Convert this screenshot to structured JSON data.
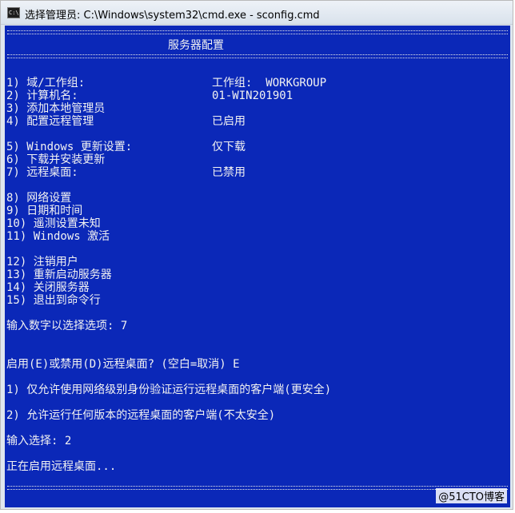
{
  "window": {
    "title": "选择管理员: C:\\Windows\\system32\\cmd.exe - sconfig.cmd",
    "icon_text": "C:\\"
  },
  "header": {
    "title": "服务器配置"
  },
  "menu": [
    {
      "label": "1) 域/工作组:",
      "value": "工作组:  WORKGROUP"
    },
    {
      "label": "2) 计算机名:",
      "value": "01-WIN201901"
    },
    {
      "label": "3) 添加本地管理员",
      "value": ""
    },
    {
      "label": "4) 配置远程管理",
      "value": "已启用"
    },
    {
      "label": "5) Windows 更新设置:",
      "value": "仅下载"
    },
    {
      "label": "6) 下载并安装更新",
      "value": ""
    },
    {
      "label": "7) 远程桌面:",
      "value": "已禁用"
    },
    {
      "label": "8) 网络设置",
      "value": ""
    },
    {
      "label": "9) 日期和时间",
      "value": ""
    },
    {
      "label": "10) 遥测设置未知",
      "value": ""
    },
    {
      "label": "11) Windows 激活",
      "value": ""
    },
    {
      "label": "12) 注销用户",
      "value": ""
    },
    {
      "label": "13) 重新启动服务器",
      "value": ""
    },
    {
      "label": "14) 关闭服务器",
      "value": ""
    },
    {
      "label": "15) 退出到命令行",
      "value": ""
    }
  ],
  "prompts": {
    "select_option": "输入数字以选择选项: 7",
    "rdp_question": "启用(E)或禁用(D)远程桌面? (空白=取消) E",
    "rdp_option_1": "1) 仅允许使用网络级别身份验证运行远程桌面的客户端(更安全)",
    "rdp_option_2": "2) 允许运行任何版本的远程桌面的客户端(不太安全)",
    "input_select": "输入选择: 2",
    "status": "正在启用远程桌面..."
  },
  "watermark": "@51CTO博客"
}
